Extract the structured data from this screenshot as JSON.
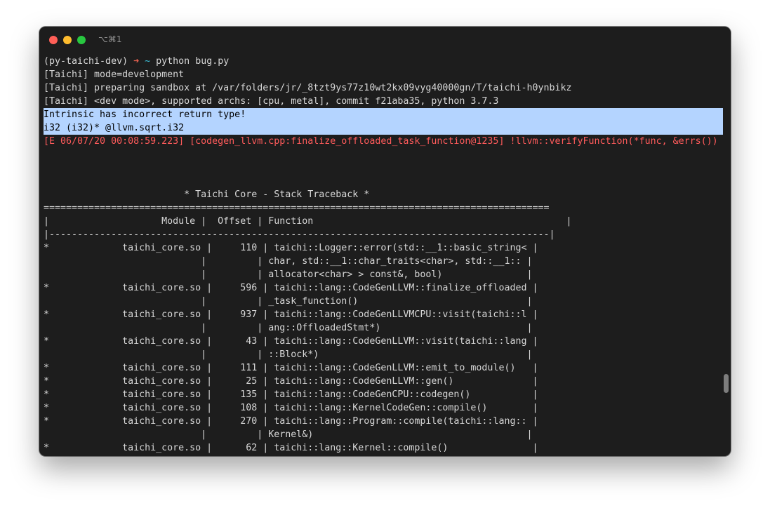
{
  "window": {
    "shortcut": "⌥⌘1",
    "colors": {
      "background": "#1d1d1d",
      "text": "#d7d7d7",
      "error": "#ff5b5b",
      "selection": "#b4d4ff"
    }
  },
  "prompt": {
    "env": "(py-taichi-dev) ",
    "arrow": "➜",
    "dir": "~",
    "command": "python bug.py"
  },
  "log_lines": [
    "[Taichi] mode=development",
    "[Taichi] preparing sandbox at /var/folders/jr/_8tzt9ys77z10wt2kx09vyg40000gn/T/taichi-h0ynbikz",
    "[Taichi] <dev mode>, supported archs: [cpu, metal], commit f21aba35, python 3.7.3"
  ],
  "selected_lines": [
    "Intrinsic has incorrect return type!",
    "i32 (i32)* @llvm.sqrt.i32"
  ],
  "error_line": "[E 06/07/20 00:08:59.223] [codegen_llvm.cpp:finalize_offloaded_task_function@1235] !llvm::verifyFunction(*func, &errs())",
  "traceback": {
    "title": "                         * Taichi Core - Stack Traceback *",
    "rule": "==========================================================================================",
    "header": "|                    Module |  Offset | Function                                             |",
    "separator": "|-----------------------------------------------------------------------------------------|",
    "rows": [
      "*             taichi_core.so |     110 | taichi::Logger::error(std::__1::basic_string< |",
      "                            |         | char, std::__1::char_traits<char>, std::__1:: |",
      "                            |         | allocator<char> > const&, bool)               |",
      "*             taichi_core.so |     596 | taichi::lang::CodeGenLLVM::finalize_offloaded |",
      "                            |         | _task_function()                              |",
      "*             taichi_core.so |     937 | taichi::lang::CodeGenLLVMCPU::visit(taichi::l |",
      "                            |         | ang::OffloadedStmt*)                          |",
      "*             taichi_core.so |      43 | taichi::lang::CodeGenLLVM::visit(taichi::lang |",
      "                            |         | ::Block*)                                     |",
      "*             taichi_core.so |     111 | taichi::lang::CodeGenLLVM::emit_to_module()   |",
      "*             taichi_core.so |      25 | taichi::lang::CodeGenLLVM::gen()              |",
      "*             taichi_core.so |     135 | taichi::lang::CodeGenCPU::codegen()           |",
      "*             taichi_core.so |     108 | taichi::lang::KernelCodeGen::compile()        |",
      "*             taichi_core.so |     270 | taichi::lang::Program::compile(taichi::lang:: |",
      "                            |         | Kernel&)                                      |",
      "*             taichi_core.so |      62 | taichi::lang::Kernel::compile()               |"
    ]
  }
}
